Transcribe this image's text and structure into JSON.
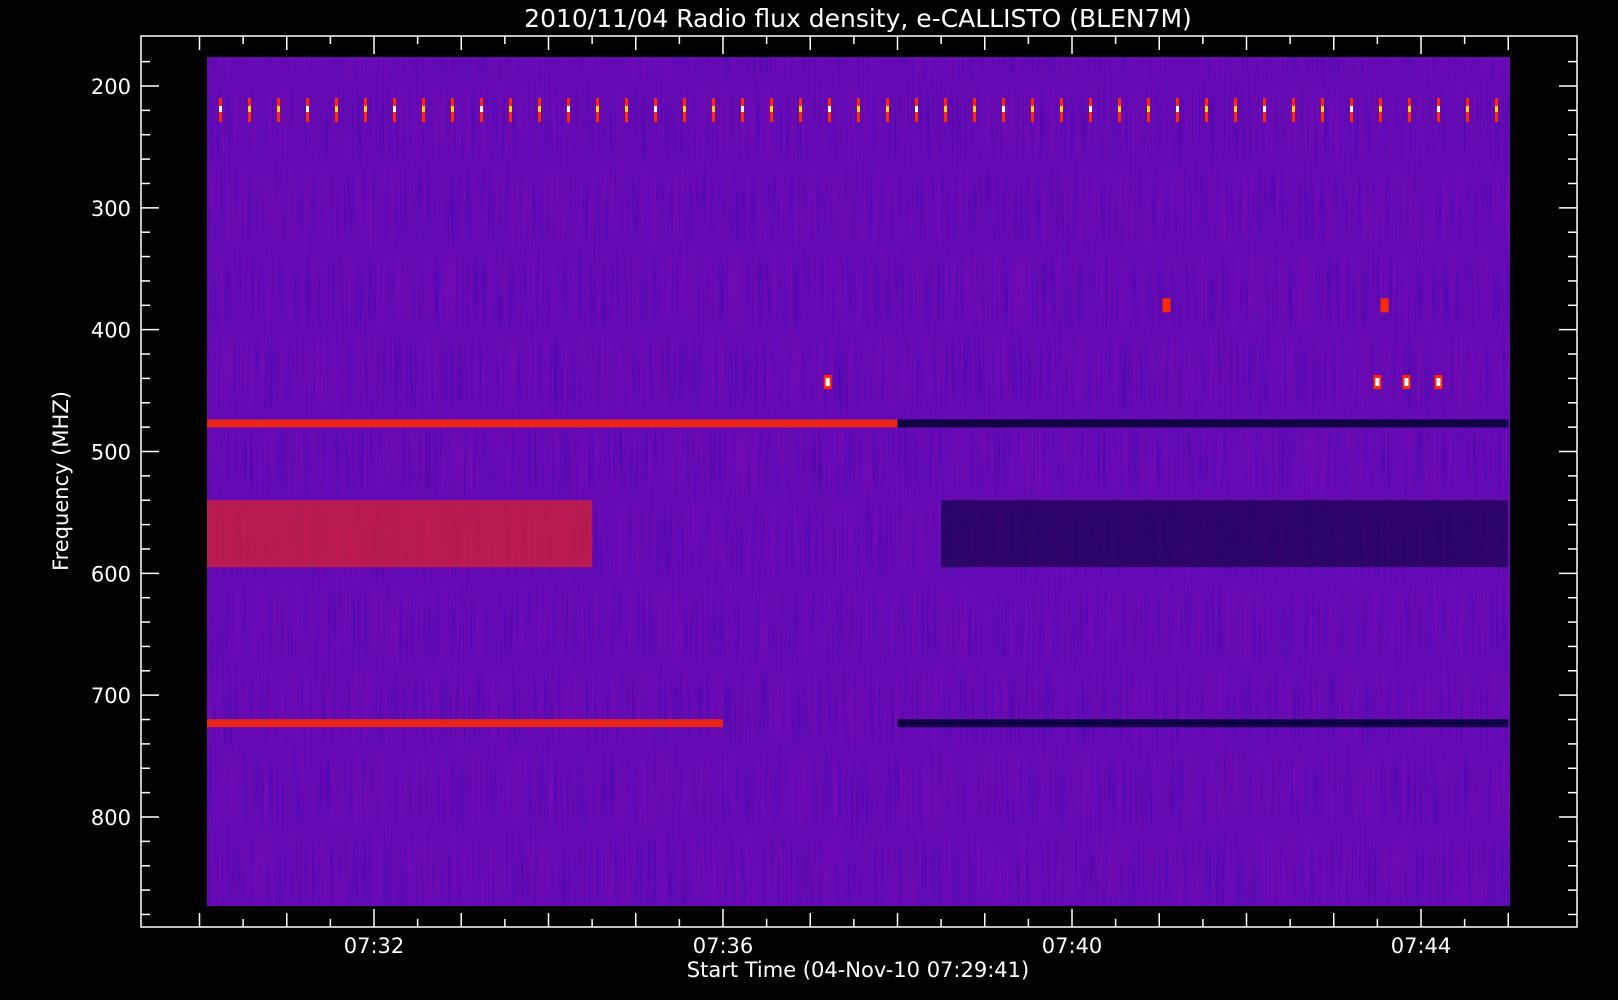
{
  "chart_data": {
    "type": "heatmap",
    "title": "2010/11/04  Radio flux density, e-CALLISTO (BLEN7M)",
    "xlabel": "Start Time (04-Nov-10 07:29:41)",
    "ylabel": "Frequency (MHZ)",
    "x_tick_labels": [
      "07:32",
      "07:36",
      "07:40",
      "07:44"
    ],
    "y_tick_labels": [
      "200",
      "300",
      "400",
      "500",
      "600",
      "700",
      "800"
    ],
    "x_range": [
      "07:29:41",
      "07:45:00"
    ],
    "y_range": [
      160,
      880
    ],
    "y_inverted": true,
    "colormap": {
      "background": "#2a16e6",
      "low": "#000030",
      "mid": "#8c1c4a",
      "high": "#ff2a00",
      "peak": "#ffffff"
    },
    "features": [
      {
        "type": "band",
        "freq_mhz": 477,
        "start": "07:29:41",
        "end": "07:38:00",
        "intensity": "high"
      },
      {
        "type": "band",
        "freq_mhz": 477,
        "start": "07:38:00",
        "end": "07:45:00",
        "intensity": "low"
      },
      {
        "type": "region",
        "freq_mhz_min": 540,
        "freq_mhz_max": 595,
        "start": "07:29:41",
        "end": "07:34:30",
        "intensity": "high"
      },
      {
        "type": "region",
        "freq_mhz_min": 540,
        "freq_mhz_max": 595,
        "start": "07:38:30",
        "end": "07:45:00",
        "intensity": "low"
      },
      {
        "type": "band",
        "freq_mhz": 723,
        "start": "07:29:41",
        "end": "07:36:00",
        "intensity": "high"
      },
      {
        "type": "band",
        "freq_mhz": 723,
        "start": "07:38:00",
        "end": "07:45:00",
        "intensity": "low"
      },
      {
        "type": "periodic_spikes",
        "freq_mhz_min": 200,
        "freq_mhz_max": 228,
        "start": "07:29:41",
        "end": "07:45:00",
        "intensity": "peak"
      },
      {
        "type": "burst",
        "freq_mhz": 443,
        "time": "07:37:12",
        "intensity": "peak"
      },
      {
        "type": "burst",
        "freq_mhz": 443,
        "time": "07:43:30",
        "intensity": "peak"
      },
      {
        "type": "burst",
        "freq_mhz": 443,
        "time": "07:43:50",
        "intensity": "peak"
      },
      {
        "type": "burst",
        "freq_mhz": 443,
        "time": "07:44:12",
        "intensity": "peak"
      },
      {
        "type": "burst",
        "freq_mhz": 380,
        "time": "07:41:05",
        "intensity": "high"
      },
      {
        "type": "burst",
        "freq_mhz": 380,
        "time": "07:43:35",
        "intensity": "high"
      }
    ]
  }
}
